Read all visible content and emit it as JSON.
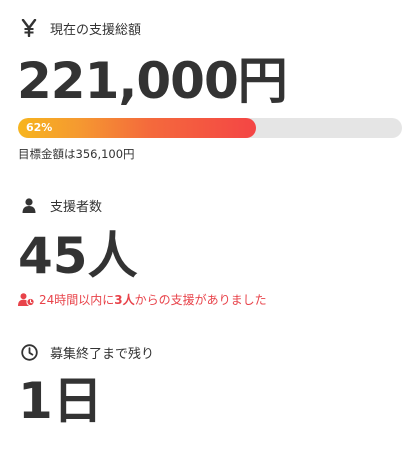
{
  "total": {
    "icon": "yen-icon",
    "label": "現在の支援総額",
    "amount": "221,000円",
    "progress_percent": 62,
    "progress_label": "62%",
    "goal_text": "目標金額は356,100円"
  },
  "supporters": {
    "icon": "user-icon",
    "label": "支援者数",
    "count": "45人",
    "recent_prefix": "24時間以内に",
    "recent_count": "3人",
    "recent_suffix": "からの支援がありました"
  },
  "remaining": {
    "icon": "clock-icon",
    "label": "募集終了まで残り",
    "value": "1日"
  },
  "colors": {
    "text": "#333333",
    "accent_red": "#e8434a",
    "progress_start": "#f7b51e",
    "progress_end": "#f44545",
    "progress_track": "#e5e5e5"
  }
}
